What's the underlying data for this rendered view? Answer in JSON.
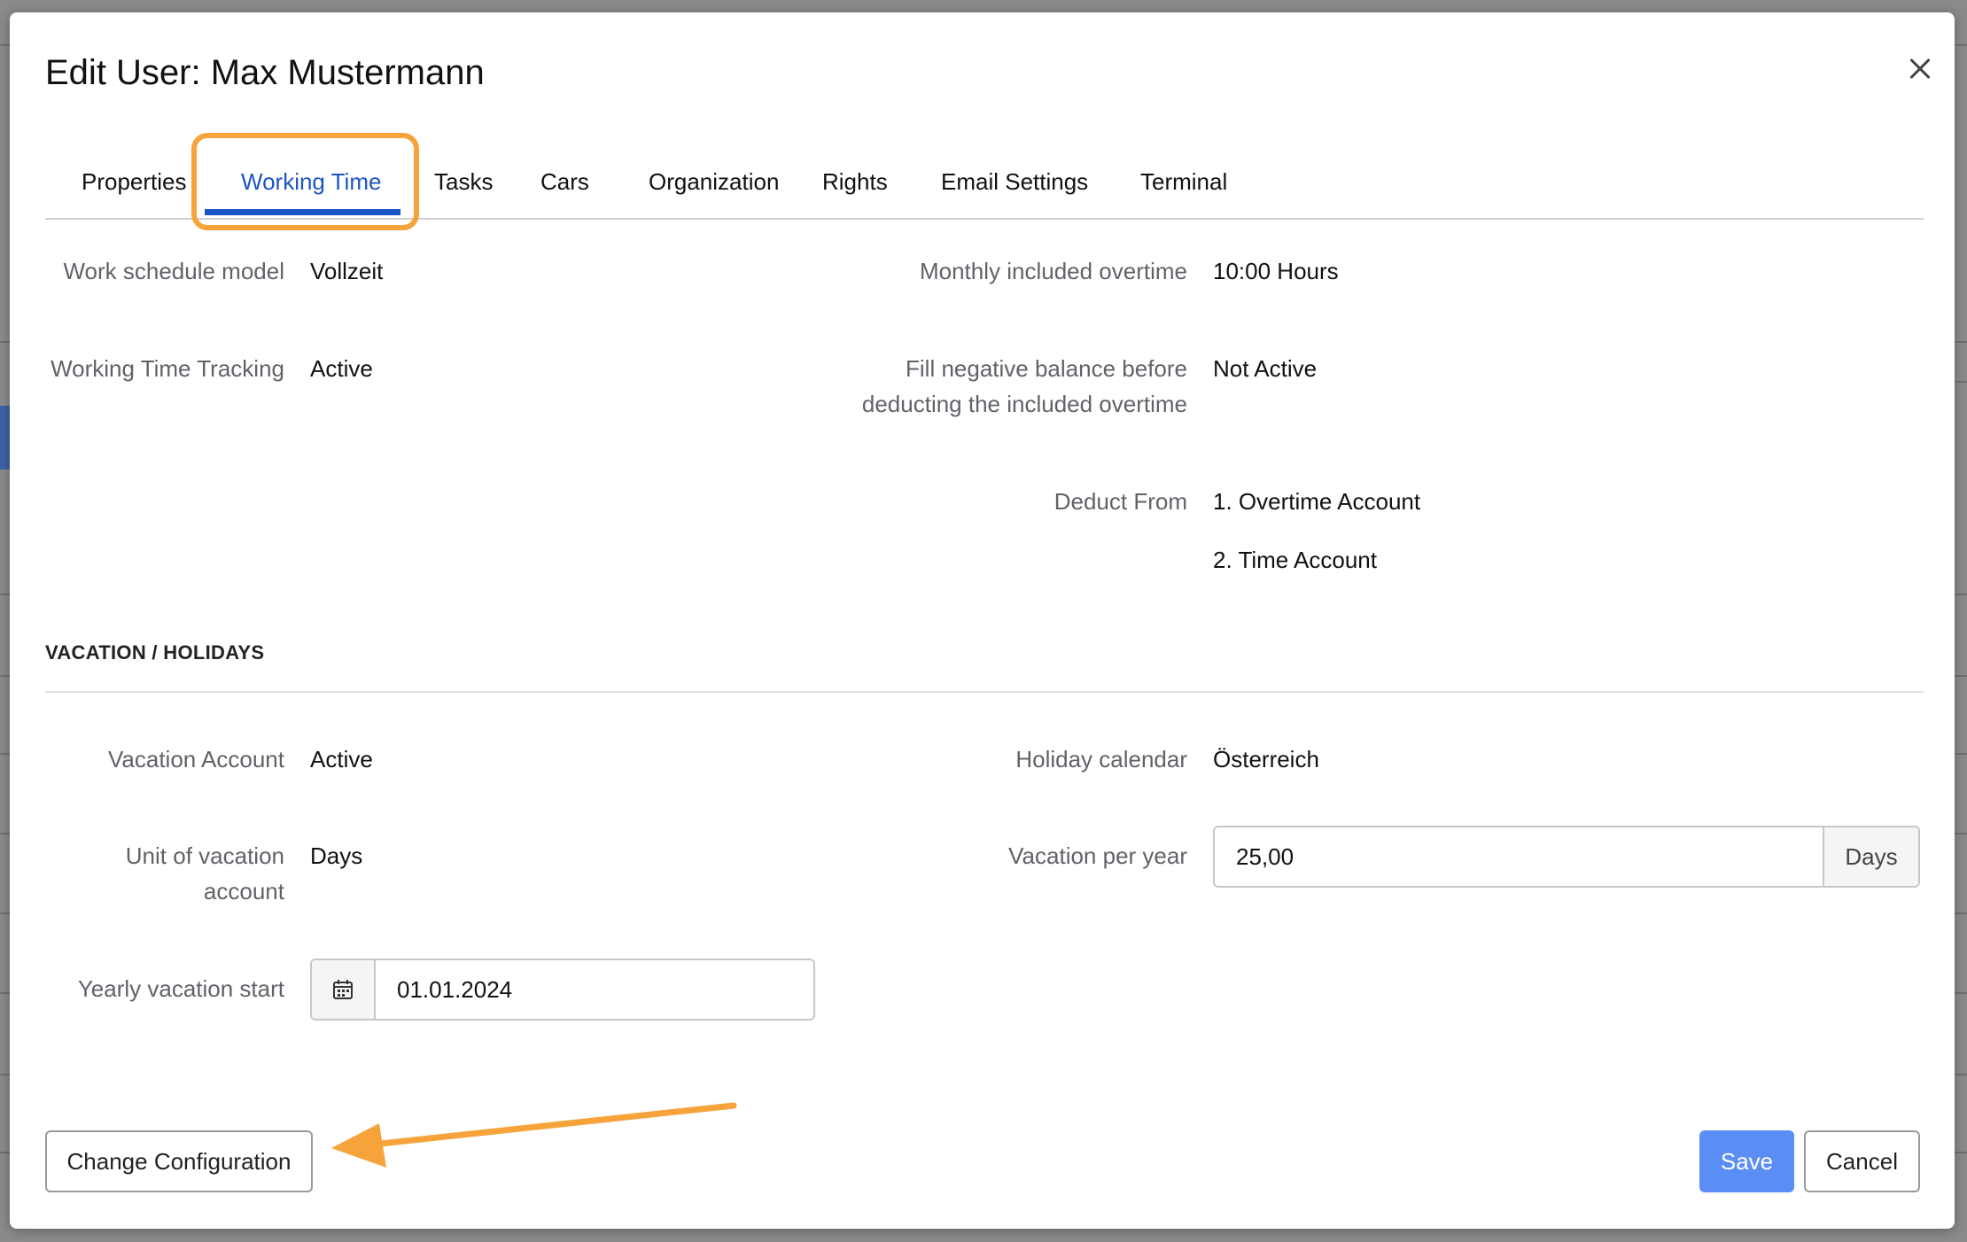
{
  "dialog": {
    "title": "Edit User: Max Mustermann",
    "close_icon": "close-icon"
  },
  "tabs": [
    {
      "label": "Properties"
    },
    {
      "label": "Working Time",
      "active": true
    },
    {
      "label": "Tasks"
    },
    {
      "label": "Cars"
    },
    {
      "label": "Organization"
    },
    {
      "label": "Rights"
    },
    {
      "label": "Email Settings"
    },
    {
      "label": "Terminal"
    }
  ],
  "working_time": {
    "schedule_label": "Work schedule model",
    "schedule_value": "Vollzeit",
    "tracking_label": "Working Time Tracking",
    "tracking_value": "Active",
    "overtime_label": "Monthly included overtime",
    "overtime_value": "10:00 Hours",
    "fill_label": "Fill negative balance before deducting the included overtime",
    "fill_value": "Not Active",
    "deduct_label": "Deduct From",
    "deduct_items": [
      "1. Overtime Account",
      "2. Time Account"
    ]
  },
  "vacation": {
    "section_title": "VACATION / HOLIDAYS",
    "account_label": "Vacation Account",
    "account_value": "Active",
    "unit_label": "Unit of vacation account",
    "unit_value": "Days",
    "start_label": "Yearly vacation start",
    "start_value": "01.01.2024",
    "holiday_label": "Holiday calendar",
    "holiday_value": "Österreich",
    "per_year_label": "Vacation per year",
    "per_year_value": "25,00",
    "per_year_unit": "Days"
  },
  "footer": {
    "change_config_label": "Change Configuration",
    "save_label": "Save",
    "cancel_label": "Cancel"
  },
  "colors": {
    "accent": "#1a55c4",
    "highlight": "#f7a33c",
    "primary_button": "#5b8ef4"
  }
}
